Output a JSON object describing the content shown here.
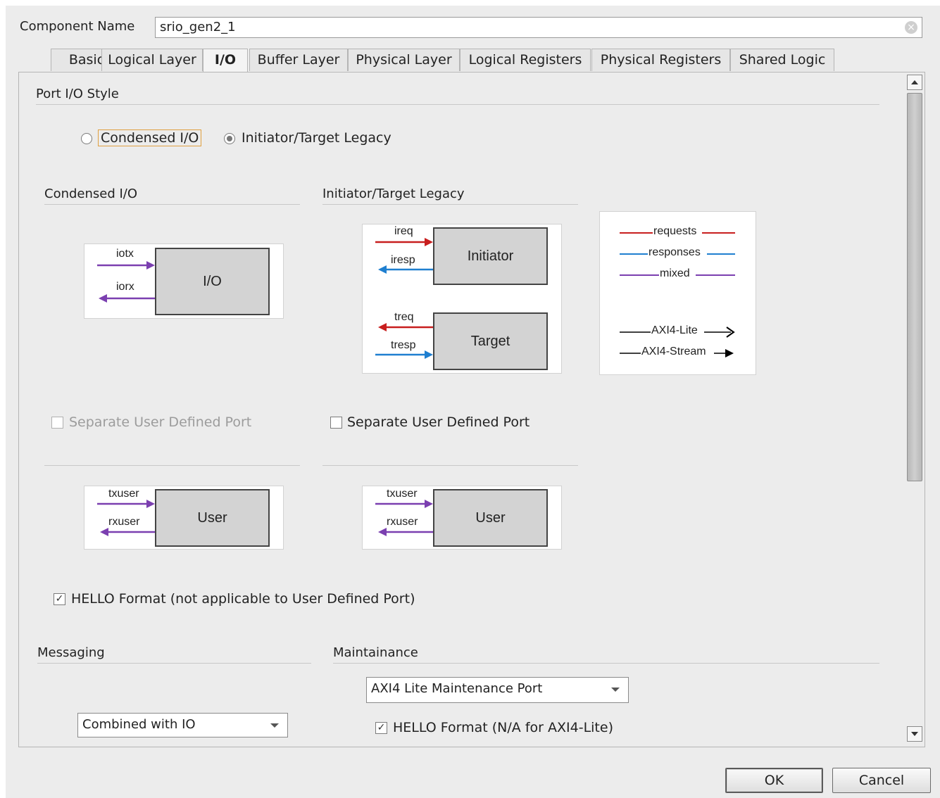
{
  "component_name": {
    "label": "Component Name",
    "value": "srio_gen2_1"
  },
  "tabs": [
    "Basic",
    "Logical Layer",
    "I/O",
    "Buffer Layer",
    "Physical Layer",
    "Logical Registers",
    "Physical Registers",
    "Shared Logic"
  ],
  "active_tab": "I/O",
  "port_style": {
    "heading": "Port I/O Style",
    "option_condensed": "Condensed I/O",
    "option_legacy": "Initiator/Target Legacy",
    "selected": "Initiator/Target Legacy"
  },
  "condensed": {
    "heading": "Condensed I/O",
    "block": "I/O",
    "sig_tx": "iotx",
    "sig_rx": "iorx",
    "separate_port": "Separate User Defined Port",
    "user_block": "User",
    "user_tx": "txuser",
    "user_rx": "rxuser"
  },
  "legacy": {
    "heading": "Initiator/Target Legacy",
    "initiator": "Initiator",
    "target": "Target",
    "ireq": "ireq",
    "iresp": "iresp",
    "treq": "treq",
    "tresp": "tresp",
    "separate_port": "Separate User Defined Port",
    "user_block": "User",
    "user_tx": "txuser",
    "user_rx": "rxuser"
  },
  "legend": {
    "requests": "requests",
    "responses": "responses",
    "mixed": "mixed",
    "axi_lite": "AXI4-Lite",
    "axi_stream": "AXI4-Stream",
    "colors": {
      "requests": "#c81e1e",
      "responses": "#1f7fd0",
      "mixed": "#7b3fb0"
    }
  },
  "hello_format": {
    "label": "HELLO Format (not applicable to User Defined Port)",
    "checked": true
  },
  "messaging": {
    "heading": "Messaging",
    "selected": "Combined with IO"
  },
  "maintainance": {
    "heading": "Maintainance",
    "selected": "AXI4 Lite Maintenance Port",
    "hello_label": "HELLO Format (N/A for AXI4-Lite)",
    "hello_checked": true
  },
  "buttons": {
    "ok": "OK",
    "cancel": "Cancel"
  }
}
